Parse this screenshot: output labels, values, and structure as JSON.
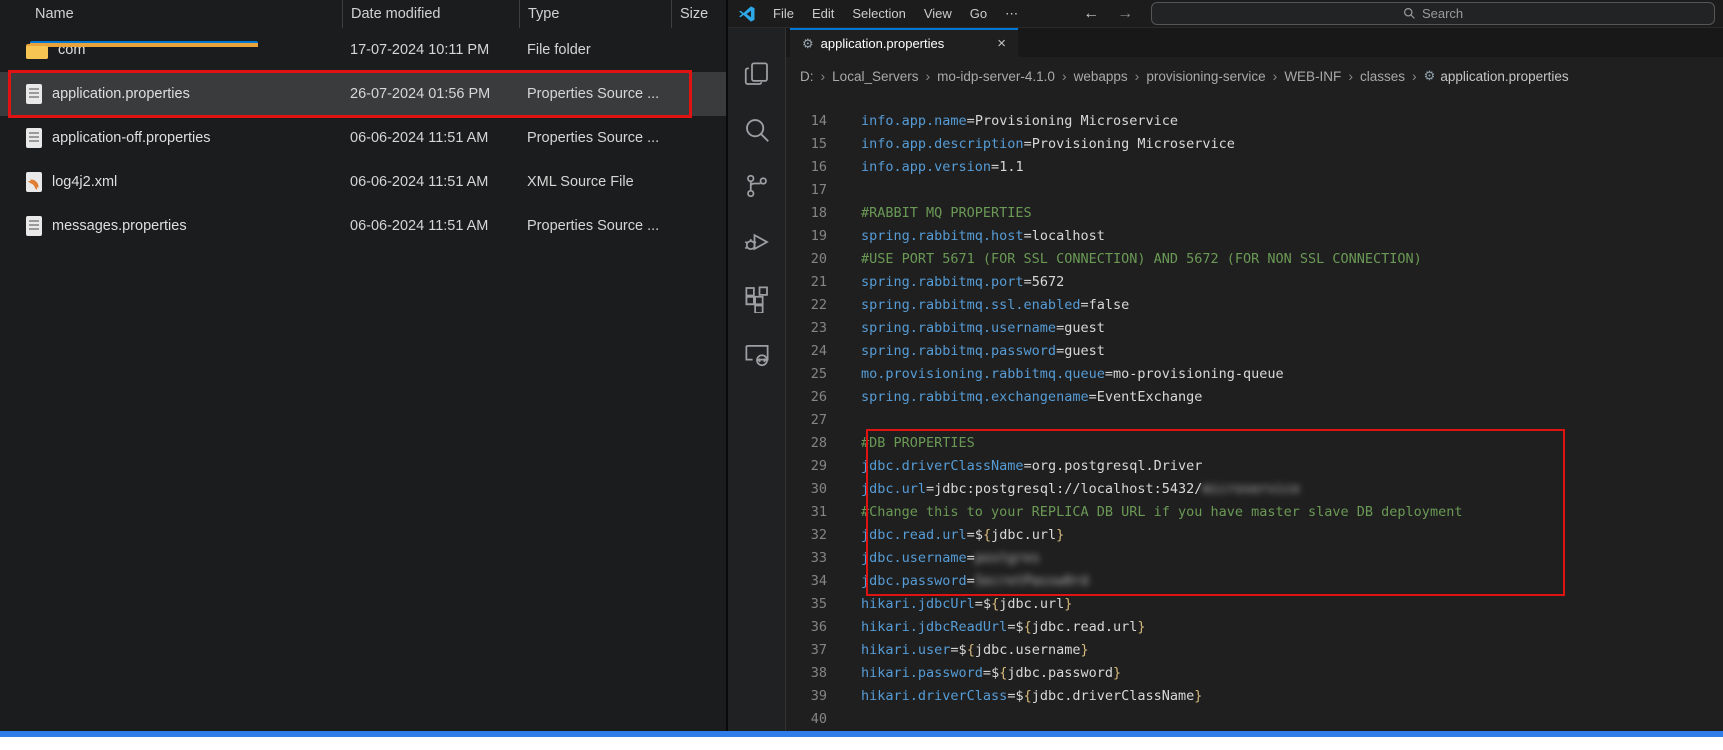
{
  "colors": {
    "accent_blue": "#0078d4",
    "window_bottom_line": "#2e7de9",
    "highlight_red": "#e01212",
    "editor_bg": "#1f1f1f",
    "key_blue": "#569cd6",
    "comment_green": "#6a9955",
    "brace_gold": "#d7ba7d",
    "folder_yellow": "#f6c452"
  },
  "explorer": {
    "columns": [
      "Name",
      "Date modified",
      "Type",
      "Size"
    ],
    "rows": [
      {
        "name": "com",
        "date": "17-07-2024 10:11 PM",
        "type": "File folder",
        "size": "",
        "icon": "folder-icon",
        "selected": false,
        "red_boxed": false
      },
      {
        "name": "application.properties",
        "date": "26-07-2024 01:56 PM",
        "type": "Properties Source ...",
        "size": "",
        "icon": "properties-file-icon",
        "selected": true,
        "red_boxed": true
      },
      {
        "name": "application-off.properties",
        "date": "06-06-2024 11:51 AM",
        "type": "Properties Source ...",
        "size": "",
        "icon": "properties-file-icon",
        "selected": false,
        "red_boxed": false
      },
      {
        "name": "log4j2.xml",
        "date": "06-06-2024 11:51 AM",
        "type": "XML Source File",
        "size": "",
        "icon": "xml-file-icon",
        "selected": false,
        "red_boxed": false
      },
      {
        "name": "messages.properties",
        "date": "06-06-2024 11:51 AM",
        "type": "Properties Source ...",
        "size": "",
        "icon": "properties-file-icon",
        "selected": false,
        "red_boxed": false
      }
    ]
  },
  "vscode": {
    "title_bar": {
      "menus": [
        "File",
        "Edit",
        "Selection",
        "View",
        "Go",
        "⋯"
      ],
      "back_arrow": "←",
      "forward_arrow": "→",
      "search_placeholder": "Search"
    },
    "activity_bar": {
      "icons": [
        "explorer-icon",
        "search-icon",
        "source-control-icon",
        "run-debug-icon",
        "extensions-icon",
        "remote-explorer-icon"
      ]
    },
    "tab": {
      "label": "application.properties",
      "icon": "gear-icon",
      "close": "×"
    },
    "breadcrumb": {
      "items": [
        "D:",
        "Local_Servers",
        "mo-idp-server-4.1.0",
        "webapps",
        "provisioning-service",
        "WEB-INF",
        "classes",
        "application.properties"
      ],
      "separator": "›",
      "last_item_icon": "gear-icon"
    },
    "editor": {
      "first_line": 14,
      "last_line": 40,
      "red_box": {
        "from_line": 28,
        "to_line": 34
      },
      "lines": [
        {
          "n": 14,
          "segs": [
            [
              "key",
              "info.app.name"
            ],
            [
              "op",
              "="
            ],
            [
              "val",
              "Provisioning Microservice"
            ]
          ]
        },
        {
          "n": 15,
          "segs": [
            [
              "key",
              "info.app.description"
            ],
            [
              "op",
              "="
            ],
            [
              "val",
              "Provisioning Microservice"
            ]
          ]
        },
        {
          "n": 16,
          "segs": [
            [
              "key",
              "info.app.version"
            ],
            [
              "op",
              "="
            ],
            [
              "val",
              "1.1"
            ]
          ]
        },
        {
          "n": 17,
          "segs": []
        },
        {
          "n": 18,
          "segs": [
            [
              "comment",
              "#RABBIT MQ PROPERTIES"
            ]
          ]
        },
        {
          "n": 19,
          "segs": [
            [
              "key",
              "spring.rabbitmq.host"
            ],
            [
              "op",
              "="
            ],
            [
              "val",
              "localhost"
            ]
          ]
        },
        {
          "n": 20,
          "segs": [
            [
              "comment",
              "#USE PORT 5671 (FOR SSL CONNECTION) AND 5672 (FOR NON SSL CONNECTION)"
            ]
          ]
        },
        {
          "n": 21,
          "segs": [
            [
              "key",
              "spring.rabbitmq.port"
            ],
            [
              "op",
              "="
            ],
            [
              "val",
              "5672"
            ]
          ]
        },
        {
          "n": 22,
          "segs": [
            [
              "key",
              "spring.rabbitmq.ssl.enabled"
            ],
            [
              "op",
              "="
            ],
            [
              "val",
              "false"
            ]
          ]
        },
        {
          "n": 23,
          "segs": [
            [
              "key",
              "spring.rabbitmq.username"
            ],
            [
              "op",
              "="
            ],
            [
              "val",
              "guest"
            ]
          ]
        },
        {
          "n": 24,
          "segs": [
            [
              "key",
              "spring.rabbitmq.password"
            ],
            [
              "op",
              "="
            ],
            [
              "val",
              "guest"
            ]
          ]
        },
        {
          "n": 25,
          "segs": [
            [
              "key",
              "mo.provisioning.rabbitmq.queue"
            ],
            [
              "op",
              "="
            ],
            [
              "val",
              "mo-provisioning-queue"
            ]
          ]
        },
        {
          "n": 26,
          "segs": [
            [
              "key",
              "spring.rabbitmq.exchangename"
            ],
            [
              "op",
              "="
            ],
            [
              "val",
              "EventExchange"
            ]
          ]
        },
        {
          "n": 27,
          "segs": []
        },
        {
          "n": 28,
          "segs": [
            [
              "comment",
              "#DB PROPERTIES"
            ]
          ]
        },
        {
          "n": 29,
          "segs": [
            [
              "key",
              "jdbc.driverClassName"
            ],
            [
              "op",
              "="
            ],
            [
              "val",
              "org.postgresql.Driver"
            ]
          ]
        },
        {
          "n": 30,
          "segs": [
            [
              "key",
              "jdbc.url"
            ],
            [
              "op",
              "="
            ],
            [
              "val",
              "jdbc:postgresql://localhost:5432/"
            ],
            [
              "redacted",
              "microservice"
            ]
          ]
        },
        {
          "n": 31,
          "segs": [
            [
              "comment",
              "#Change this to your REPLICA DB URL if you have master slave DB deployment"
            ]
          ]
        },
        {
          "n": 32,
          "segs": [
            [
              "key",
              "jdbc.read.url"
            ],
            [
              "op",
              "="
            ],
            [
              "val",
              "$"
            ],
            [
              "brace",
              "{"
            ],
            [
              "val",
              "jdbc.url"
            ],
            [
              "brace",
              "}"
            ]
          ]
        },
        {
          "n": 33,
          "segs": [
            [
              "key",
              "jdbc.username"
            ],
            [
              "op",
              "="
            ],
            [
              "redacted",
              "postgres"
            ]
          ]
        },
        {
          "n": 34,
          "segs": [
            [
              "key",
              "jdbc.password"
            ],
            [
              "op",
              "="
            ],
            [
              "redacted",
              "SecretPassw0rd"
            ]
          ]
        },
        {
          "n": 35,
          "segs": [
            [
              "key",
              "hikari.jdbcUrl"
            ],
            [
              "op",
              "="
            ],
            [
              "val",
              "$"
            ],
            [
              "brace",
              "{"
            ],
            [
              "val",
              "jdbc.url"
            ],
            [
              "brace",
              "}"
            ]
          ]
        },
        {
          "n": 36,
          "segs": [
            [
              "key",
              "hikari.jdbcReadUrl"
            ],
            [
              "op",
              "="
            ],
            [
              "val",
              "$"
            ],
            [
              "brace",
              "{"
            ],
            [
              "val",
              "jdbc.read.url"
            ],
            [
              "brace",
              "}"
            ]
          ]
        },
        {
          "n": 37,
          "segs": [
            [
              "key",
              "hikari.user"
            ],
            [
              "op",
              "="
            ],
            [
              "val",
              "$"
            ],
            [
              "brace",
              "{"
            ],
            [
              "val",
              "jdbc.username"
            ],
            [
              "brace",
              "}"
            ]
          ]
        },
        {
          "n": 38,
          "segs": [
            [
              "key",
              "hikari.password"
            ],
            [
              "op",
              "="
            ],
            [
              "val",
              "$"
            ],
            [
              "brace",
              "{"
            ],
            [
              "val",
              "jdbc.password"
            ],
            [
              "brace",
              "}"
            ]
          ]
        },
        {
          "n": 39,
          "segs": [
            [
              "key",
              "hikari.driverClass"
            ],
            [
              "op",
              "="
            ],
            [
              "val",
              "$"
            ],
            [
              "brace",
              "{"
            ],
            [
              "val",
              "jdbc.driverClassName"
            ],
            [
              "brace",
              "}"
            ]
          ]
        },
        {
          "n": 40,
          "segs": []
        }
      ]
    }
  }
}
